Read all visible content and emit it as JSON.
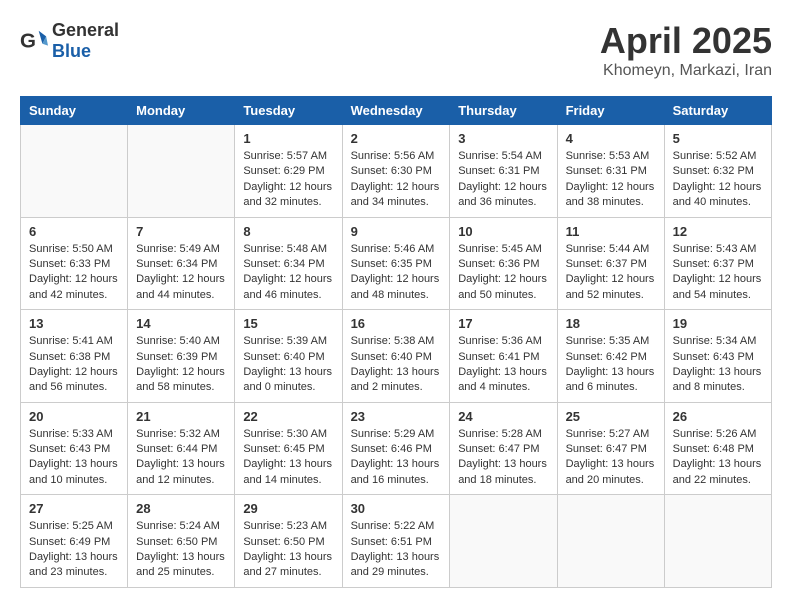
{
  "header": {
    "logo_general": "General",
    "logo_blue": "Blue",
    "month_year": "April 2025",
    "location": "Khomeyn, Markazi, Iran"
  },
  "weekdays": [
    "Sunday",
    "Monday",
    "Tuesday",
    "Wednesday",
    "Thursday",
    "Friday",
    "Saturday"
  ],
  "weeks": [
    [
      {
        "day": "",
        "sunrise": "",
        "sunset": "",
        "daylight": ""
      },
      {
        "day": "",
        "sunrise": "",
        "sunset": "",
        "daylight": ""
      },
      {
        "day": "1",
        "sunrise": "Sunrise: 5:57 AM",
        "sunset": "Sunset: 6:29 PM",
        "daylight": "Daylight: 12 hours and 32 minutes."
      },
      {
        "day": "2",
        "sunrise": "Sunrise: 5:56 AM",
        "sunset": "Sunset: 6:30 PM",
        "daylight": "Daylight: 12 hours and 34 minutes."
      },
      {
        "day": "3",
        "sunrise": "Sunrise: 5:54 AM",
        "sunset": "Sunset: 6:31 PM",
        "daylight": "Daylight: 12 hours and 36 minutes."
      },
      {
        "day": "4",
        "sunrise": "Sunrise: 5:53 AM",
        "sunset": "Sunset: 6:31 PM",
        "daylight": "Daylight: 12 hours and 38 minutes."
      },
      {
        "day": "5",
        "sunrise": "Sunrise: 5:52 AM",
        "sunset": "Sunset: 6:32 PM",
        "daylight": "Daylight: 12 hours and 40 minutes."
      }
    ],
    [
      {
        "day": "6",
        "sunrise": "Sunrise: 5:50 AM",
        "sunset": "Sunset: 6:33 PM",
        "daylight": "Daylight: 12 hours and 42 minutes."
      },
      {
        "day": "7",
        "sunrise": "Sunrise: 5:49 AM",
        "sunset": "Sunset: 6:34 PM",
        "daylight": "Daylight: 12 hours and 44 minutes."
      },
      {
        "day": "8",
        "sunrise": "Sunrise: 5:48 AM",
        "sunset": "Sunset: 6:34 PM",
        "daylight": "Daylight: 12 hours and 46 minutes."
      },
      {
        "day": "9",
        "sunrise": "Sunrise: 5:46 AM",
        "sunset": "Sunset: 6:35 PM",
        "daylight": "Daylight: 12 hours and 48 minutes."
      },
      {
        "day": "10",
        "sunrise": "Sunrise: 5:45 AM",
        "sunset": "Sunset: 6:36 PM",
        "daylight": "Daylight: 12 hours and 50 minutes."
      },
      {
        "day": "11",
        "sunrise": "Sunrise: 5:44 AM",
        "sunset": "Sunset: 6:37 PM",
        "daylight": "Daylight: 12 hours and 52 minutes."
      },
      {
        "day": "12",
        "sunrise": "Sunrise: 5:43 AM",
        "sunset": "Sunset: 6:37 PM",
        "daylight": "Daylight: 12 hours and 54 minutes."
      }
    ],
    [
      {
        "day": "13",
        "sunrise": "Sunrise: 5:41 AM",
        "sunset": "Sunset: 6:38 PM",
        "daylight": "Daylight: 12 hours and 56 minutes."
      },
      {
        "day": "14",
        "sunrise": "Sunrise: 5:40 AM",
        "sunset": "Sunset: 6:39 PM",
        "daylight": "Daylight: 12 hours and 58 minutes."
      },
      {
        "day": "15",
        "sunrise": "Sunrise: 5:39 AM",
        "sunset": "Sunset: 6:40 PM",
        "daylight": "Daylight: 13 hours and 0 minutes."
      },
      {
        "day": "16",
        "sunrise": "Sunrise: 5:38 AM",
        "sunset": "Sunset: 6:40 PM",
        "daylight": "Daylight: 13 hours and 2 minutes."
      },
      {
        "day": "17",
        "sunrise": "Sunrise: 5:36 AM",
        "sunset": "Sunset: 6:41 PM",
        "daylight": "Daylight: 13 hours and 4 minutes."
      },
      {
        "day": "18",
        "sunrise": "Sunrise: 5:35 AM",
        "sunset": "Sunset: 6:42 PM",
        "daylight": "Daylight: 13 hours and 6 minutes."
      },
      {
        "day": "19",
        "sunrise": "Sunrise: 5:34 AM",
        "sunset": "Sunset: 6:43 PM",
        "daylight": "Daylight: 13 hours and 8 minutes."
      }
    ],
    [
      {
        "day": "20",
        "sunrise": "Sunrise: 5:33 AM",
        "sunset": "Sunset: 6:43 PM",
        "daylight": "Daylight: 13 hours and 10 minutes."
      },
      {
        "day": "21",
        "sunrise": "Sunrise: 5:32 AM",
        "sunset": "Sunset: 6:44 PM",
        "daylight": "Daylight: 13 hours and 12 minutes."
      },
      {
        "day": "22",
        "sunrise": "Sunrise: 5:30 AM",
        "sunset": "Sunset: 6:45 PM",
        "daylight": "Daylight: 13 hours and 14 minutes."
      },
      {
        "day": "23",
        "sunrise": "Sunrise: 5:29 AM",
        "sunset": "Sunset: 6:46 PM",
        "daylight": "Daylight: 13 hours and 16 minutes."
      },
      {
        "day": "24",
        "sunrise": "Sunrise: 5:28 AM",
        "sunset": "Sunset: 6:47 PM",
        "daylight": "Daylight: 13 hours and 18 minutes."
      },
      {
        "day": "25",
        "sunrise": "Sunrise: 5:27 AM",
        "sunset": "Sunset: 6:47 PM",
        "daylight": "Daylight: 13 hours and 20 minutes."
      },
      {
        "day": "26",
        "sunrise": "Sunrise: 5:26 AM",
        "sunset": "Sunset: 6:48 PM",
        "daylight": "Daylight: 13 hours and 22 minutes."
      }
    ],
    [
      {
        "day": "27",
        "sunrise": "Sunrise: 5:25 AM",
        "sunset": "Sunset: 6:49 PM",
        "daylight": "Daylight: 13 hours and 23 minutes."
      },
      {
        "day": "28",
        "sunrise": "Sunrise: 5:24 AM",
        "sunset": "Sunset: 6:50 PM",
        "daylight": "Daylight: 13 hours and 25 minutes."
      },
      {
        "day": "29",
        "sunrise": "Sunrise: 5:23 AM",
        "sunset": "Sunset: 6:50 PM",
        "daylight": "Daylight: 13 hours and 27 minutes."
      },
      {
        "day": "30",
        "sunrise": "Sunrise: 5:22 AM",
        "sunset": "Sunset: 6:51 PM",
        "daylight": "Daylight: 13 hours and 29 minutes."
      },
      {
        "day": "",
        "sunrise": "",
        "sunset": "",
        "daylight": ""
      },
      {
        "day": "",
        "sunrise": "",
        "sunset": "",
        "daylight": ""
      },
      {
        "day": "",
        "sunrise": "",
        "sunset": "",
        "daylight": ""
      }
    ]
  ]
}
